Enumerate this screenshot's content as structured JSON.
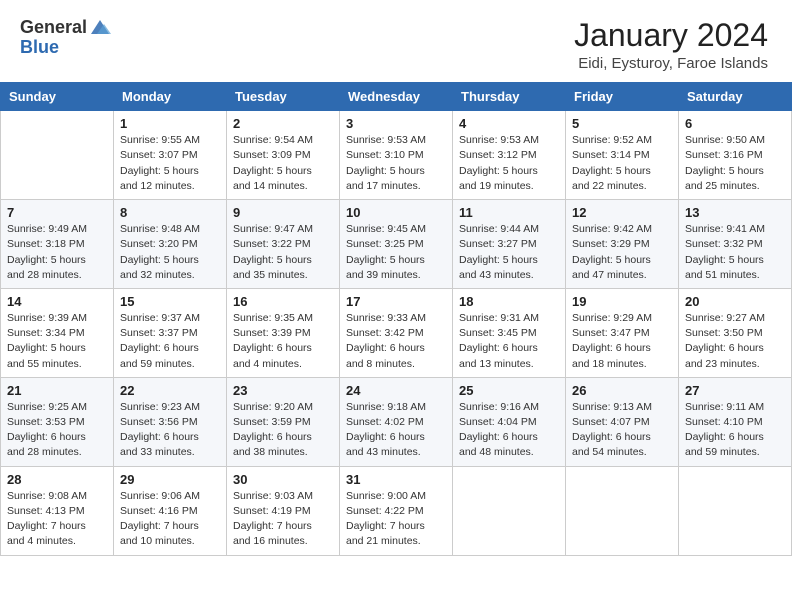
{
  "header": {
    "logo_general": "General",
    "logo_blue": "Blue",
    "month_title": "January 2024",
    "location": "Eidi, Eysturoy, Faroe Islands"
  },
  "days_of_week": [
    "Sunday",
    "Monday",
    "Tuesday",
    "Wednesday",
    "Thursday",
    "Friday",
    "Saturday"
  ],
  "weeks": [
    [
      {
        "day": "",
        "info": ""
      },
      {
        "day": "1",
        "info": "Sunrise: 9:55 AM\nSunset: 3:07 PM\nDaylight: 5 hours\nand 12 minutes."
      },
      {
        "day": "2",
        "info": "Sunrise: 9:54 AM\nSunset: 3:09 PM\nDaylight: 5 hours\nand 14 minutes."
      },
      {
        "day": "3",
        "info": "Sunrise: 9:53 AM\nSunset: 3:10 PM\nDaylight: 5 hours\nand 17 minutes."
      },
      {
        "day": "4",
        "info": "Sunrise: 9:53 AM\nSunset: 3:12 PM\nDaylight: 5 hours\nand 19 minutes."
      },
      {
        "day": "5",
        "info": "Sunrise: 9:52 AM\nSunset: 3:14 PM\nDaylight: 5 hours\nand 22 minutes."
      },
      {
        "day": "6",
        "info": "Sunrise: 9:50 AM\nSunset: 3:16 PM\nDaylight: 5 hours\nand 25 minutes."
      }
    ],
    [
      {
        "day": "7",
        "info": "Sunrise: 9:49 AM\nSunset: 3:18 PM\nDaylight: 5 hours\nand 28 minutes."
      },
      {
        "day": "8",
        "info": "Sunrise: 9:48 AM\nSunset: 3:20 PM\nDaylight: 5 hours\nand 32 minutes."
      },
      {
        "day": "9",
        "info": "Sunrise: 9:47 AM\nSunset: 3:22 PM\nDaylight: 5 hours\nand 35 minutes."
      },
      {
        "day": "10",
        "info": "Sunrise: 9:45 AM\nSunset: 3:25 PM\nDaylight: 5 hours\nand 39 minutes."
      },
      {
        "day": "11",
        "info": "Sunrise: 9:44 AM\nSunset: 3:27 PM\nDaylight: 5 hours\nand 43 minutes."
      },
      {
        "day": "12",
        "info": "Sunrise: 9:42 AM\nSunset: 3:29 PM\nDaylight: 5 hours\nand 47 minutes."
      },
      {
        "day": "13",
        "info": "Sunrise: 9:41 AM\nSunset: 3:32 PM\nDaylight: 5 hours\nand 51 minutes."
      }
    ],
    [
      {
        "day": "14",
        "info": "Sunrise: 9:39 AM\nSunset: 3:34 PM\nDaylight: 5 hours\nand 55 minutes."
      },
      {
        "day": "15",
        "info": "Sunrise: 9:37 AM\nSunset: 3:37 PM\nDaylight: 6 hours\nand 59 minutes."
      },
      {
        "day": "16",
        "info": "Sunrise: 9:35 AM\nSunset: 3:39 PM\nDaylight: 6 hours\nand 4 minutes."
      },
      {
        "day": "17",
        "info": "Sunrise: 9:33 AM\nSunset: 3:42 PM\nDaylight: 6 hours\nand 8 minutes."
      },
      {
        "day": "18",
        "info": "Sunrise: 9:31 AM\nSunset: 3:45 PM\nDaylight: 6 hours\nand 13 minutes."
      },
      {
        "day": "19",
        "info": "Sunrise: 9:29 AM\nSunset: 3:47 PM\nDaylight: 6 hours\nand 18 minutes."
      },
      {
        "day": "20",
        "info": "Sunrise: 9:27 AM\nSunset: 3:50 PM\nDaylight: 6 hours\nand 23 minutes."
      }
    ],
    [
      {
        "day": "21",
        "info": "Sunrise: 9:25 AM\nSunset: 3:53 PM\nDaylight: 6 hours\nand 28 minutes."
      },
      {
        "day": "22",
        "info": "Sunrise: 9:23 AM\nSunset: 3:56 PM\nDaylight: 6 hours\nand 33 minutes."
      },
      {
        "day": "23",
        "info": "Sunrise: 9:20 AM\nSunset: 3:59 PM\nDaylight: 6 hours\nand 38 minutes."
      },
      {
        "day": "24",
        "info": "Sunrise: 9:18 AM\nSunset: 4:02 PM\nDaylight: 6 hours\nand 43 minutes."
      },
      {
        "day": "25",
        "info": "Sunrise: 9:16 AM\nSunset: 4:04 PM\nDaylight: 6 hours\nand 48 minutes."
      },
      {
        "day": "26",
        "info": "Sunrise: 9:13 AM\nSunset: 4:07 PM\nDaylight: 6 hours\nand 54 minutes."
      },
      {
        "day": "27",
        "info": "Sunrise: 9:11 AM\nSunset: 4:10 PM\nDaylight: 6 hours\nand 59 minutes."
      }
    ],
    [
      {
        "day": "28",
        "info": "Sunrise: 9:08 AM\nSunset: 4:13 PM\nDaylight: 7 hours\nand 4 minutes."
      },
      {
        "day": "29",
        "info": "Sunrise: 9:06 AM\nSunset: 4:16 PM\nDaylight: 7 hours\nand 10 minutes."
      },
      {
        "day": "30",
        "info": "Sunrise: 9:03 AM\nSunset: 4:19 PM\nDaylight: 7 hours\nand 16 minutes."
      },
      {
        "day": "31",
        "info": "Sunrise: 9:00 AM\nSunset: 4:22 PM\nDaylight: 7 hours\nand 21 minutes."
      },
      {
        "day": "",
        "info": ""
      },
      {
        "day": "",
        "info": ""
      },
      {
        "day": "",
        "info": ""
      }
    ]
  ]
}
